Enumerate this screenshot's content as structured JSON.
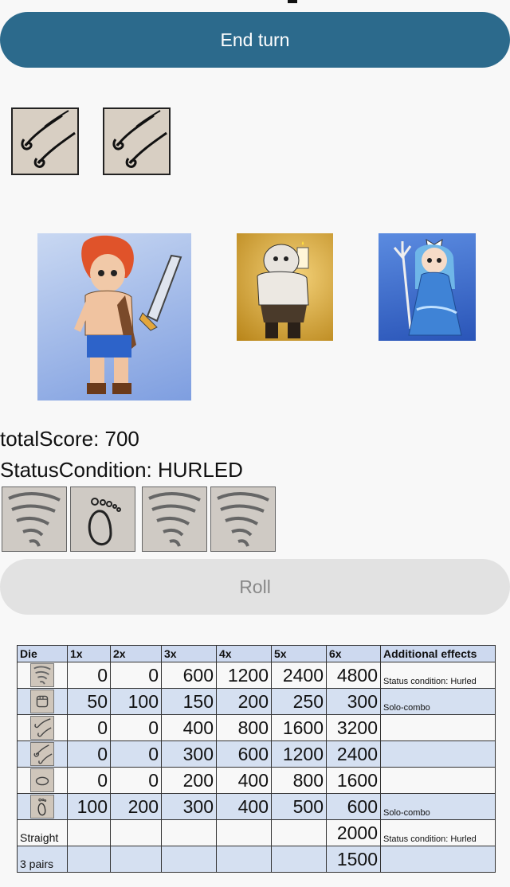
{
  "buttons": {
    "end_turn": "End turn",
    "roll": "Roll"
  },
  "opponent_cards": [
    {
      "icon": "wind-swirl-icon"
    },
    {
      "icon": "wind-swirl-icon"
    }
  ],
  "characters": [
    {
      "icon": "swordsman-character-portrait"
    },
    {
      "icon": "brute-character-portrait"
    },
    {
      "icon": "sea-queen-character-portrait"
    }
  ],
  "player": {
    "total_score": "totalScore: 700",
    "status_condition": "StatusCondition: HURLED"
  },
  "dice": [
    {
      "icon": "tornado-die-icon"
    },
    {
      "icon": "footprint-die-icon"
    },
    {
      "icon": "tornado-die-icon"
    },
    {
      "icon": "tornado-die-icon"
    }
  ],
  "score_table": {
    "headers": [
      "Die",
      "1x",
      "2x",
      "3x",
      "4x",
      "5x",
      "6x",
      "Additional effects"
    ],
    "rows": [
      {
        "die": "tornado-icon",
        "label": "",
        "values": [
          "0",
          "0",
          "600",
          "1200",
          "2400",
          "4800"
        ],
        "effect": "Status condition: Hurled"
      },
      {
        "die": "fist-icon",
        "label": "",
        "values": [
          "50",
          "100",
          "150",
          "200",
          "250",
          "300"
        ],
        "effect": "Solo-combo"
      },
      {
        "die": "wind-icon",
        "label": "",
        "values": [
          "0",
          "0",
          "400",
          "800",
          "1600",
          "3200"
        ],
        "effect": ""
      },
      {
        "die": "wind-swirl-icon",
        "label": "",
        "values": [
          "0",
          "0",
          "300",
          "600",
          "1200",
          "2400"
        ],
        "effect": ""
      },
      {
        "die": "stone-icon",
        "label": "",
        "values": [
          "0",
          "0",
          "200",
          "400",
          "800",
          "1600"
        ],
        "effect": ""
      },
      {
        "die": "footprint-icon",
        "label": "",
        "values": [
          "100",
          "200",
          "300",
          "400",
          "500",
          "600"
        ],
        "effect": "Solo-combo"
      },
      {
        "die": "",
        "label": "Straight",
        "values": [
          "",
          "",
          "",
          "",
          "",
          "2000"
        ],
        "effect": "Status condition: Hurled"
      },
      {
        "die": "",
        "label": "3 pairs",
        "values": [
          "",
          "",
          "",
          "",
          "",
          "1500"
        ],
        "effect": ""
      }
    ]
  }
}
